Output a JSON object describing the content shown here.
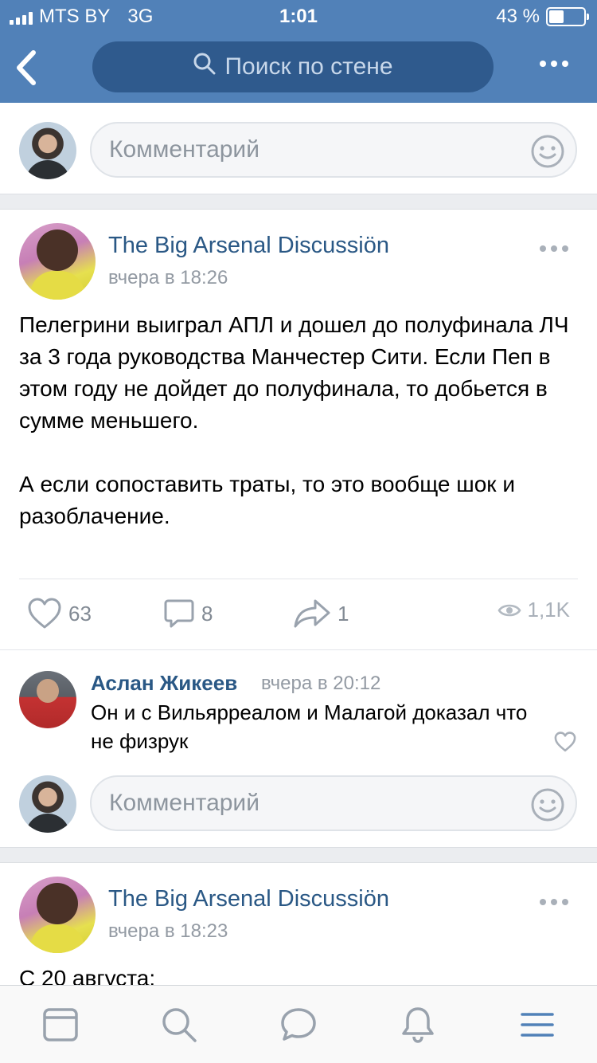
{
  "status_bar": {
    "carrier": "MTS BY",
    "network": "3G",
    "time": "1:01",
    "battery": "43 %"
  },
  "header": {
    "search_placeholder": "Поиск по стене"
  },
  "composer": {
    "placeholder": "Комментарий"
  },
  "posts": [
    {
      "author": "The Big Arsenal Discussiön",
      "time": "вчера в 18:26",
      "paragraphs": [
        "Пелегрини выиграл АПЛ и дошел до полуфинала ЛЧ за 3 года руководства Манчестер Сити. Если Пеп в этом году не дойдет до полуфинала, то добьется в сумме меньшего.",
        "А если сопоставить траты, то это вообще шок и разоблачение."
      ],
      "likes": "63",
      "comments": "8",
      "shares": "1",
      "views": "1,1K"
    },
    {
      "author": "The Big Arsenal Discussiön",
      "time": "вчера в 18:23",
      "text_start": "С 20 августа:"
    }
  ],
  "reply": {
    "name": "Аслан Жикеев",
    "time": "вчера в 20:12",
    "text": "Он и с Вильярреалом и Малагой доказал что не физрук"
  },
  "icons": {
    "back": "back-chevron-icon",
    "search": "search-icon",
    "more": "more-icon",
    "smile": "smile-icon",
    "like": "heart-icon",
    "comment": "comment-icon",
    "share": "share-arrow-icon",
    "views": "eye-icon"
  },
  "tabbar": [
    "news-tab",
    "search-tab",
    "messages-tab",
    "notifications-tab",
    "menu-tab"
  ],
  "colors": {
    "header": "#5181b8",
    "link": "#2a5885",
    "muted": "#939aa3"
  }
}
